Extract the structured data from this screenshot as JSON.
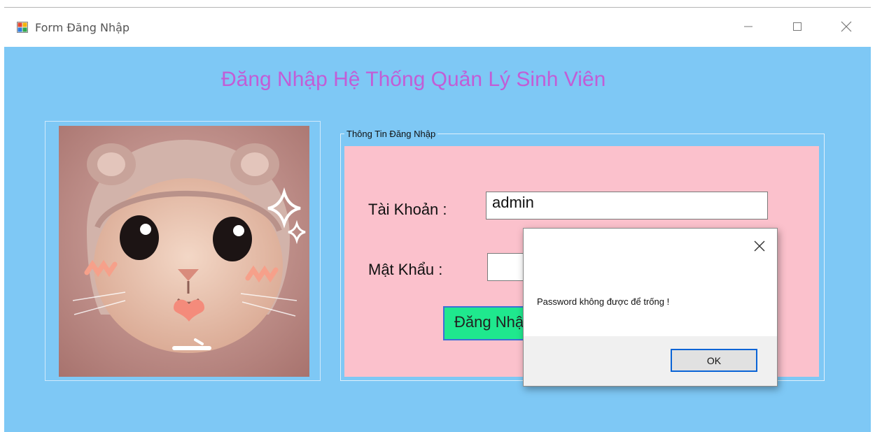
{
  "window": {
    "title": "Form Đăng Nhập",
    "icon": "winforms-app-icon",
    "controls": {
      "minimize": "minimize-icon",
      "maximize": "maximize-icon",
      "close": "close-icon"
    }
  },
  "form": {
    "heading": "Đăng Nhập Hệ Thống Quản Lý Sinh Viên",
    "picture": "cat-photo",
    "group_title": "Thông Tin Đăng Nhập",
    "username_label": "Tài Khoản :",
    "username_value": "admin",
    "password_label": "Mật Khẩu :",
    "password_value": "",
    "login_button": "Đăng Nhập"
  },
  "dialog": {
    "message": "Password không được để trống !",
    "ok_label": "OK",
    "close_icon": "close-icon"
  },
  "colors": {
    "client_bg": "#7ec8f5",
    "heading": "#c25dd6",
    "group_panel": "#fbc1cc",
    "login_button": "#1fe88e"
  }
}
